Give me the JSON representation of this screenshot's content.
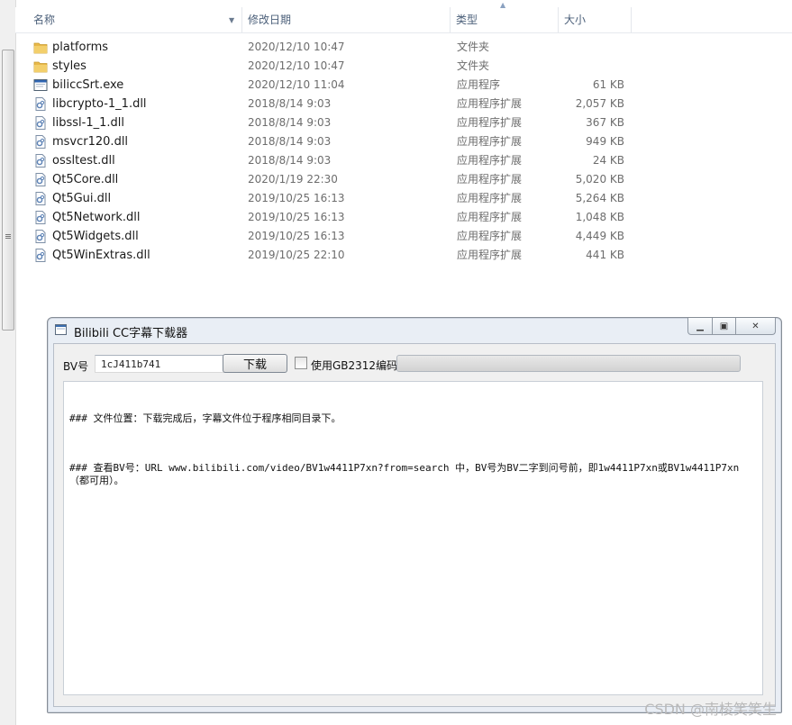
{
  "explorer": {
    "columns": {
      "name": "名称",
      "date": "修改日期",
      "type": "类型",
      "size": "大小"
    },
    "files": [
      {
        "icon": "folder-icon",
        "name": "platforms",
        "date": "2020/12/10 10:47",
        "type": "文件夹",
        "size": ""
      },
      {
        "icon": "folder-icon",
        "name": "styles",
        "date": "2020/12/10 10:47",
        "type": "文件夹",
        "size": ""
      },
      {
        "icon": "exe-icon",
        "name": "biliccSrt.exe",
        "date": "2020/12/10 11:04",
        "type": "应用程序",
        "size": "61 KB"
      },
      {
        "icon": "dll-icon",
        "name": "libcrypto-1_1.dll",
        "date": "2018/8/14 9:03",
        "type": "应用程序扩展",
        "size": "2,057 KB"
      },
      {
        "icon": "dll-icon",
        "name": "libssl-1_1.dll",
        "date": "2018/8/14 9:03",
        "type": "应用程序扩展",
        "size": "367 KB"
      },
      {
        "icon": "dll-icon",
        "name": "msvcr120.dll",
        "date": "2018/8/14 9:03",
        "type": "应用程序扩展",
        "size": "949 KB"
      },
      {
        "icon": "dll-icon",
        "name": "ossltest.dll",
        "date": "2018/8/14 9:03",
        "type": "应用程序扩展",
        "size": "24 KB"
      },
      {
        "icon": "dll-icon",
        "name": "Qt5Core.dll",
        "date": "2020/1/19 22:30",
        "type": "应用程序扩展",
        "size": "5,020 KB"
      },
      {
        "icon": "dll-icon",
        "name": "Qt5Gui.dll",
        "date": "2019/10/25 16:13",
        "type": "应用程序扩展",
        "size": "5,264 KB"
      },
      {
        "icon": "dll-icon",
        "name": "Qt5Network.dll",
        "date": "2019/10/25 16:13",
        "type": "应用程序扩展",
        "size": "1,048 KB"
      },
      {
        "icon": "dll-icon",
        "name": "Qt5Widgets.dll",
        "date": "2019/10/25 16:13",
        "type": "应用程序扩展",
        "size": "4,449 KB"
      },
      {
        "icon": "dll-icon",
        "name": "Qt5WinExtras.dll",
        "date": "2019/10/25 22:10",
        "type": "应用程序扩展",
        "size": "441 KB"
      }
    ]
  },
  "app": {
    "title": "Bilibili CC字幕下载器",
    "bv_label": "BV号",
    "bv_value": "1cJ411b741",
    "download_button": "下载",
    "gb2312_label": "使用GB2312编码",
    "gb2312_checked": false,
    "progress": 0,
    "info_paragraphs": [
      "### 文件位置：下载完成后，字幕文件位于程序相同目录下。",
      "### 查看BV号：URL www.bilibili.com/video/BV1w4411P7xn?from=search 中，BV号为BV二字到问号前，即1w4411P7xn或BV1w4411P7xn（都可用）。"
    ]
  },
  "watermark": "CSDN @南棱笑笑生",
  "colors": {
    "progress_fill": "#37b24d",
    "folder": "#e8b84a"
  }
}
